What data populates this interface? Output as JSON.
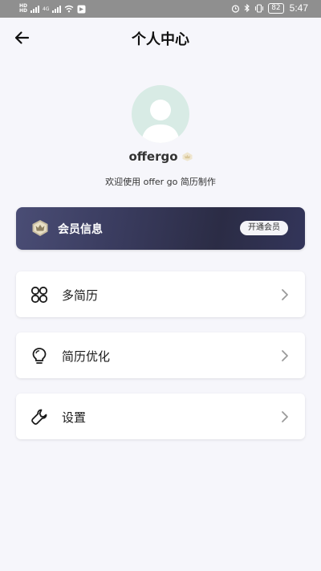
{
  "status_bar": {
    "sim_tags": [
      "HD",
      "HD"
    ],
    "network_labels": [
      "4G",
      "4G"
    ],
    "battery_level": "82",
    "time": "5:47"
  },
  "header": {
    "title": "个人中心",
    "back_icon": "arrow-left-icon"
  },
  "profile": {
    "username": "offergo",
    "badge_icon": "crown-badge-icon",
    "welcome_text": "欢迎使用 offer go 简历制作"
  },
  "membership": {
    "label": "会员信息",
    "icon": "vip-crown-icon",
    "button_label": "开通会员"
  },
  "menu": {
    "items": [
      {
        "label": "多简历",
        "icon": "grid-four-icon"
      },
      {
        "label": "简历优化",
        "icon": "lightbulb-icon"
      },
      {
        "label": "设置",
        "icon": "wrench-icon"
      }
    ]
  },
  "colors": {
    "background": "#f6f6fb",
    "member_card_gradient_start": "#4a4d75",
    "member_card_gradient_end": "#2b2c45",
    "avatar_bg": "#d8ebe5"
  }
}
